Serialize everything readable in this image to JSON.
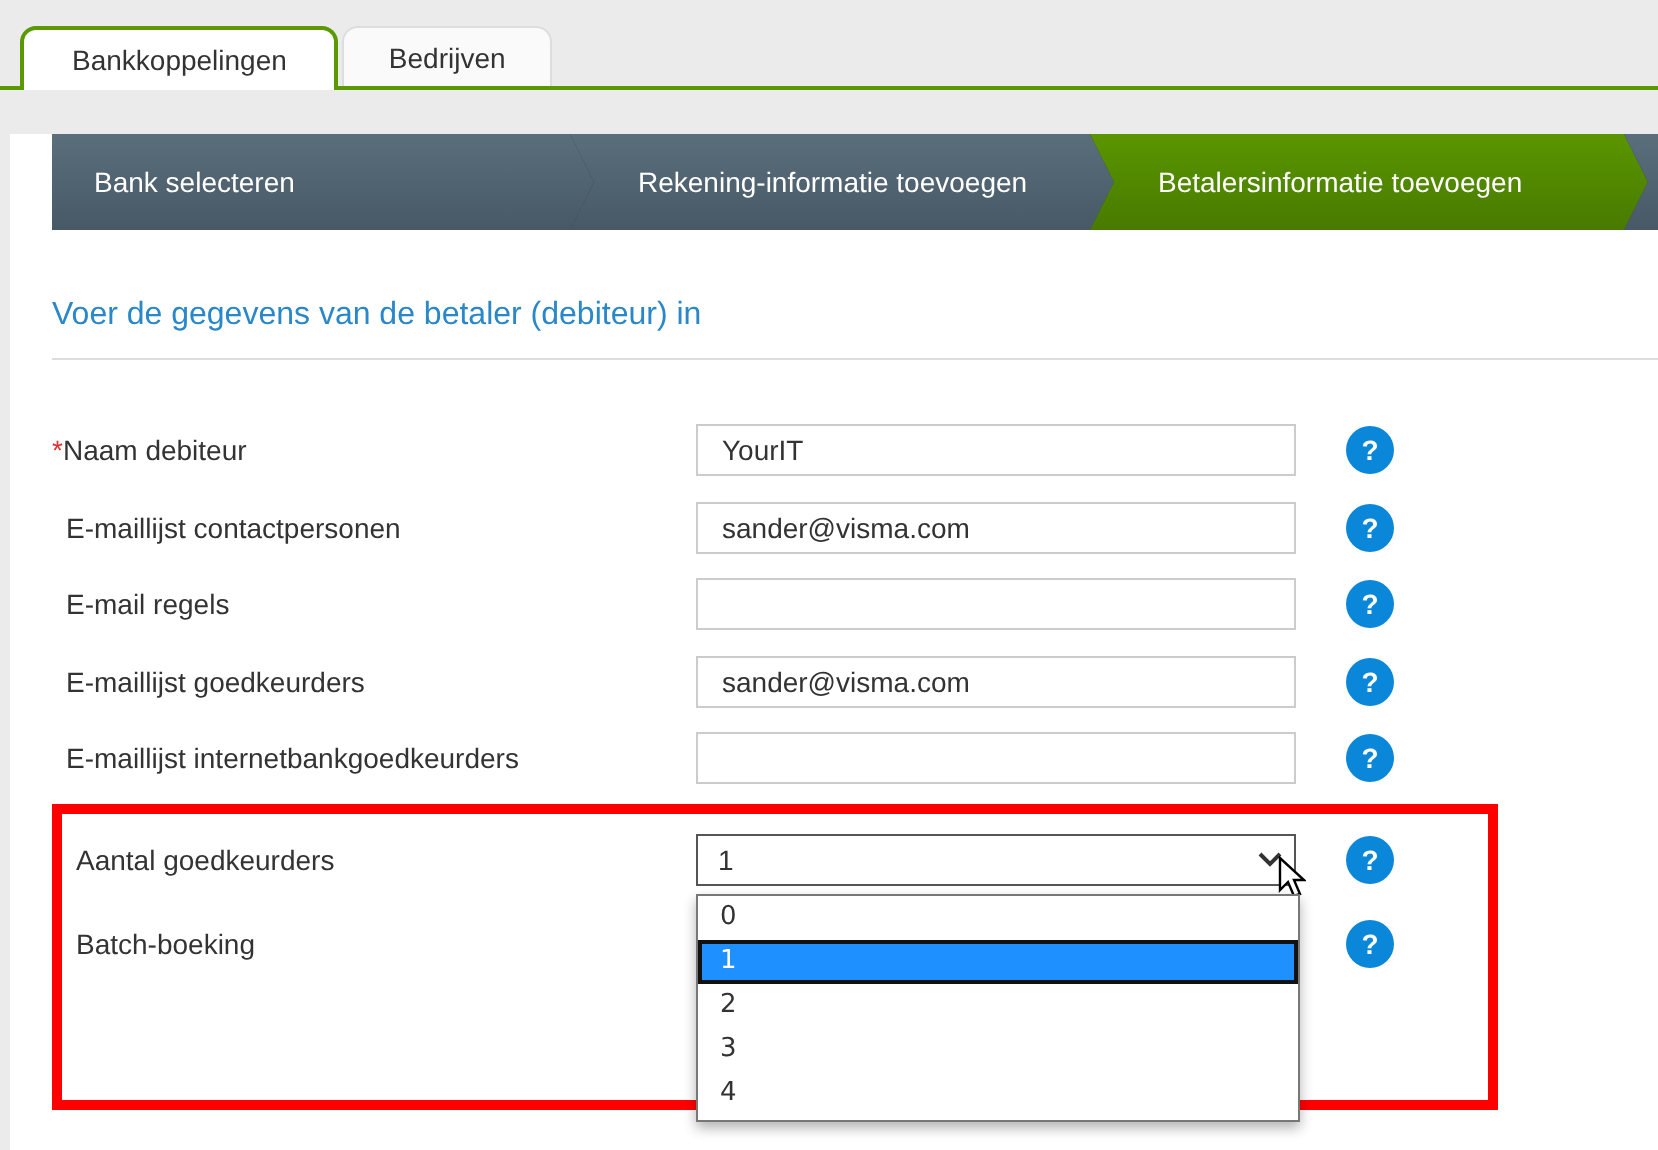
{
  "tabs": [
    {
      "label": "Bankkoppelingen",
      "selected": true
    },
    {
      "label": "Bedrijven",
      "selected": false
    }
  ],
  "steps": [
    {
      "label": "Bank selecteren",
      "selected": false
    },
    {
      "label": "Rekening-informatie toevoegen",
      "selected": false
    },
    {
      "label": "Betalersinformatie toevoegen",
      "selected": true
    },
    {
      "selected": false
    }
  ],
  "heading": "Voer de gegevens van de betaler (debiteur) in",
  "fields": [
    {
      "kind": "text",
      "required_mark": "*",
      "label": "Naam debiteur",
      "value": "YourIT",
      "help": "?"
    },
    {
      "kind": "text",
      "label": "E-maillijst contactpersonen",
      "value": "sander@visma.com",
      "help": "?"
    },
    {
      "kind": "text",
      "label": "E-mail regels",
      "help": "?"
    },
    {
      "kind": "text",
      "label": "E-maillijst goedkeurders",
      "value": "sander@visma.com",
      "help": "?"
    },
    {
      "kind": "text",
      "label": "E-maillijst internetbankgoedkeurders",
      "help": "?"
    }
  ],
  "highlighted_fields": [
    {
      "kind": "select",
      "label": "Aantal goedkeurders",
      "value": "1",
      "expanded": true,
      "help": "?",
      "options": [
        {
          "label": "0",
          "selected": false
        },
        {
          "label": "1",
          "selected": true
        },
        {
          "label": "2",
          "selected": false
        },
        {
          "label": "3",
          "selected": false
        },
        {
          "label": "4",
          "selected": false
        }
      ]
    },
    {
      "kind": "hidden",
      "label": "Batch-boeking",
      "help": "?"
    }
  ]
}
